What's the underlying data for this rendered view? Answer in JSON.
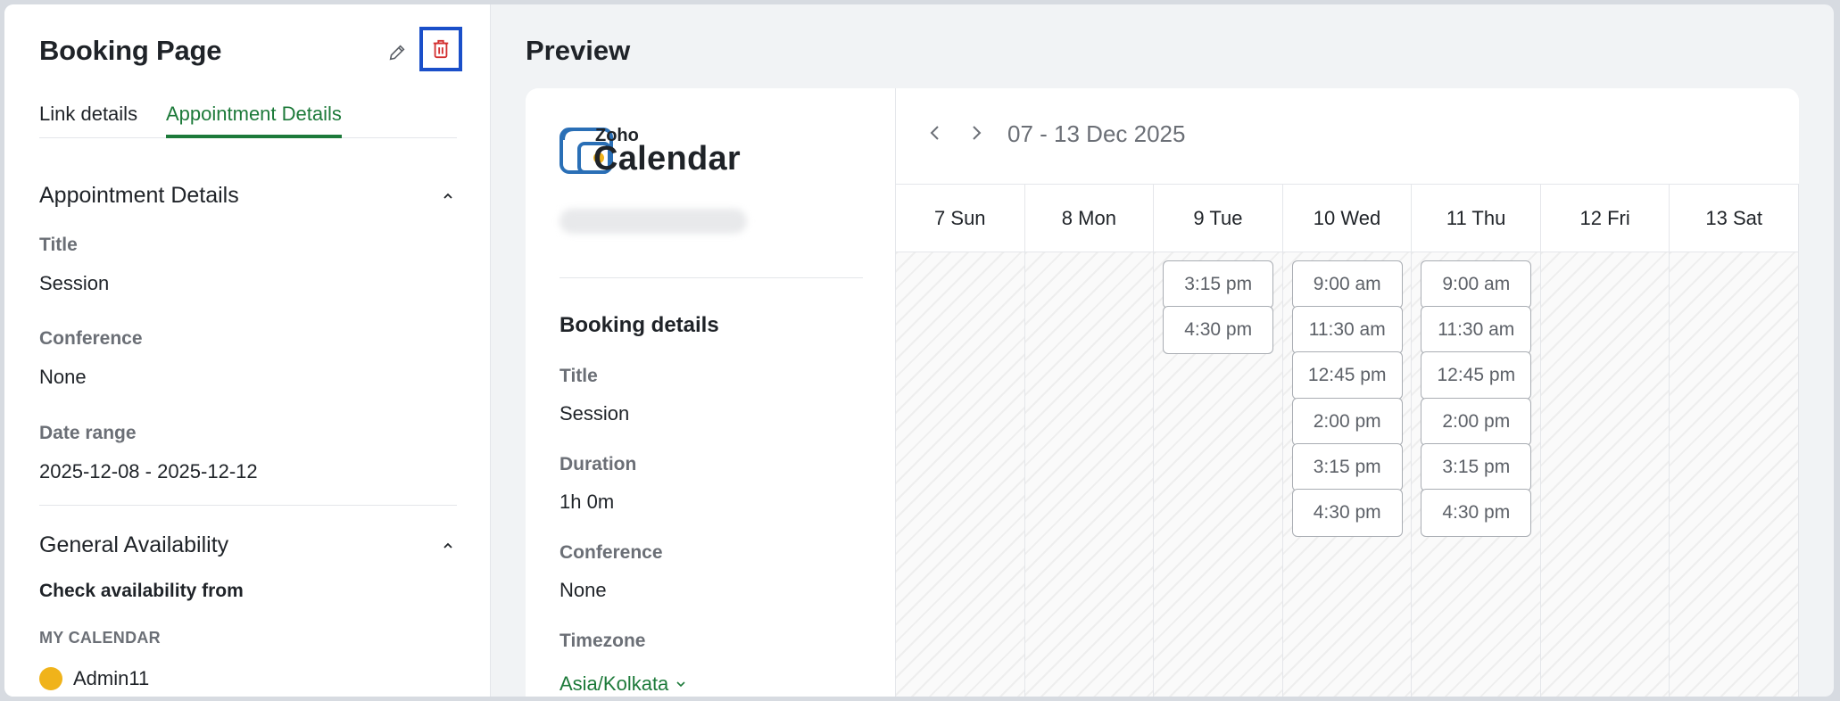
{
  "left_panel": {
    "title": "Booking Page",
    "tabs": [
      {
        "label": "Link details",
        "active": false
      },
      {
        "label": "Appointment Details",
        "active": true
      }
    ],
    "appointment_section": {
      "heading": "Appointment Details",
      "fields": [
        {
          "label": "Title",
          "value": "Session"
        },
        {
          "label": "Conference",
          "value": "None"
        },
        {
          "label": "Date range",
          "value": "2025-12-08 - 2025-12-12"
        }
      ]
    },
    "availability_section": {
      "heading": "General Availability",
      "check_from_label": "Check availability from",
      "my_calendar_label": "MY CALENDAR",
      "calendar_user": "Admin11"
    },
    "icons": {
      "edit": "pencil-icon",
      "delete": "trash-icon",
      "collapse": "chevron-up-icon"
    }
  },
  "preview": {
    "title": "Preview",
    "logo": {
      "brand_small": "Zoho",
      "brand_large": "Calendar"
    },
    "booking_details": {
      "heading": "Booking details",
      "fields": [
        {
          "label": "Title",
          "value": "Session"
        },
        {
          "label": "Duration",
          "value": "1h 0m"
        },
        {
          "label": "Conference",
          "value": "None"
        },
        {
          "label": "Timezone",
          "value": "Asia/Kolkata"
        }
      ]
    },
    "week": {
      "range": "07 - 13 Dec 2025",
      "days": [
        {
          "label": "7 Sun",
          "slots": []
        },
        {
          "label": "8 Mon",
          "slots": []
        },
        {
          "label": "9 Tue",
          "slots": [
            "3:15 pm",
            "4:30 pm"
          ]
        },
        {
          "label": "10 Wed",
          "slots": [
            "9:00 am",
            "11:30 am",
            "12:45 pm",
            "2:00 pm",
            "3:15 pm",
            "4:30 pm"
          ]
        },
        {
          "label": "11 Thu",
          "slots": [
            "9:00 am",
            "11:30 am",
            "12:45 pm",
            "2:00 pm",
            "3:15 pm",
            "4:30 pm"
          ]
        },
        {
          "label": "12 Fri",
          "slots": []
        },
        {
          "label": "13 Sat",
          "slots": []
        }
      ]
    }
  },
  "colors": {
    "accent_green": "#1d7a3a",
    "delete_red": "#d32f2f",
    "highlight_blue": "#1a4fc9",
    "avatar_yellow": "#f0b31a"
  }
}
